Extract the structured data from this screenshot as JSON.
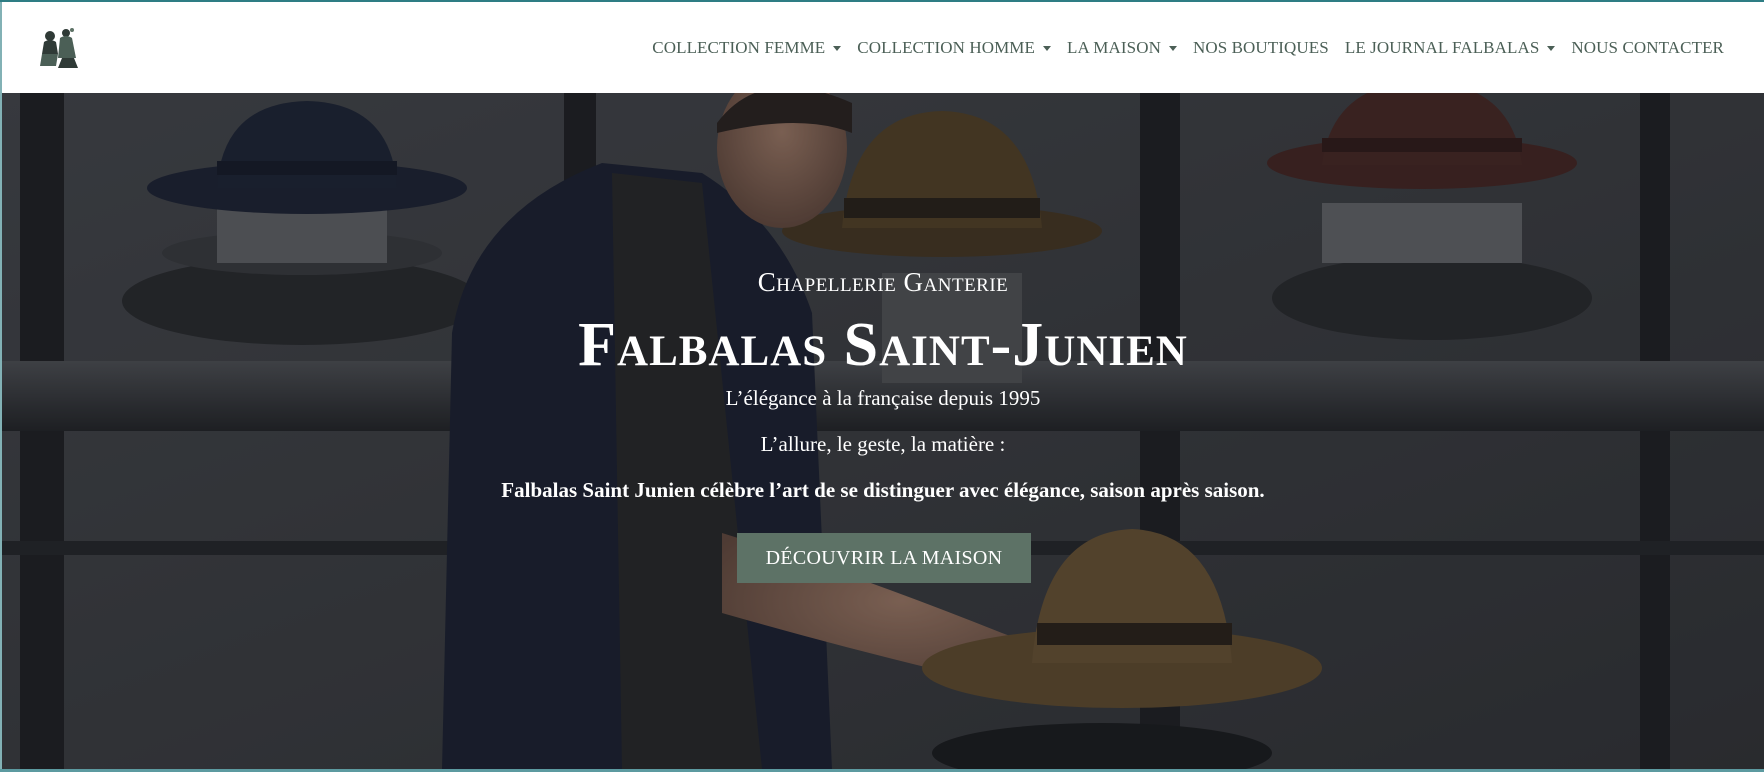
{
  "brand": {
    "logo_icon": "boutique-figure-logo-icon"
  },
  "nav": {
    "items": [
      {
        "label": "COLLECTION FEMME",
        "has_dropdown": true
      },
      {
        "label": "COLLECTION HOMME",
        "has_dropdown": true
      },
      {
        "label": "LA MAISON",
        "has_dropdown": true
      },
      {
        "label": "NOS BOUTIQUES",
        "has_dropdown": false
      },
      {
        "label": "LE JOURNAL FALBALAS",
        "has_dropdown": true
      },
      {
        "label": "NOUS CONTACTER",
        "has_dropdown": false
      }
    ]
  },
  "hero": {
    "eyebrow": "Chapellerie Ganterie",
    "title": "Falbalas Saint-Junien",
    "tagline": "L’élégance à la française depuis 1995",
    "lead": "L’allure, le geste, la matière :",
    "lead_bold": "Falbalas Saint Junien célèbre l’art de se distinguer avec élégance, saison après saison.",
    "cta_label": "DÉCOUVRIR LA MAISON"
  },
  "colors": {
    "nav_text": "#4b5f56",
    "cta_bg": "#5d7266",
    "accent_frame": "#2e7d84"
  }
}
